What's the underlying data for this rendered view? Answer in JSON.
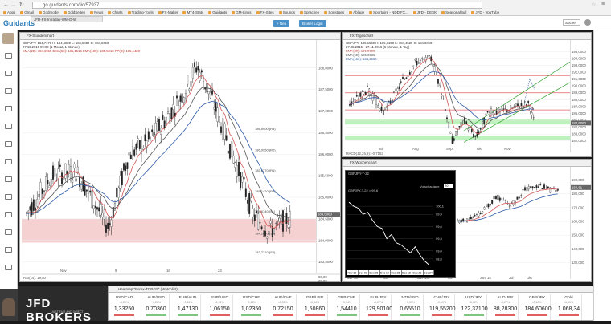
{
  "browser": {
    "url": "go.guidants.com/#c/57937",
    "bookmarks": [
      "Apps",
      "Gmail",
      "Godmode",
      "GoldSeiten",
      "News",
      "Charts",
      "Trading-Tools",
      "FX-Maker",
      "MT4-Stats",
      "Guidants",
      "GM-Links",
      "FX-Sites",
      "Sounds",
      "Sprachen",
      "Sonstiges",
      "Ablage",
      "Sportwire - NDD FX...",
      "JFD - DESK",
      "SeasonalBull",
      "JFD - YouTube"
    ]
  },
  "app": {
    "logo": "Guidants",
    "tab_label": "JFD-FX-Intraday-WM-D-W",
    "new_button": "+ Neu",
    "broker_button": "Broker Login",
    "search_label": "Suche"
  },
  "panels": {
    "stunden": {
      "title": "FX-Stundenchart",
      "info1": "GBPJPY: 184,7170  H: 184,6800  L: 184,5880  C: 184,6060",
      "info2": "27.10.2015 09:00 (1 Monat, 1 Stunde)",
      "info3": "EMA(20): 184,6965  EMA(50): 185,1516  EMA(100): 185,5016  PP(D): 185,1420",
      "price_labels": [
        "188,0000",
        "187,5000",
        "187,0000",
        "186,5000",
        "186,0000",
        "185,5000",
        "185,0000",
        "184,5000",
        "184,0000",
        "183,5000"
      ],
      "level_labels": [
        {
          "text": "186,5900 (R3)"
        },
        {
          "text": "186,0950 (R2)"
        },
        {
          "text": "185,6270 (R1)"
        },
        {
          "text": "185,1420 (PP)"
        },
        {
          "text": "184,6740 (S1)"
        },
        {
          "text": "184,1640 (S2)"
        },
        {
          "text": "183,7210 (S3)"
        }
      ],
      "current_price": "184,6060",
      "x_labels": [
        "Nov",
        "9",
        "16",
        "23"
      ],
      "rsi_label": "RSI(14): 19,50",
      "rsi_levels": [
        "80,00",
        "20,00"
      ]
    },
    "tages": {
      "title": "FX-Tageschart",
      "info1": "GBPJPY: 185,1560  H: 185,3150  L: 184,4520  C: 184,6060",
      "info2": "27.05.2015 - 27.11.2015 (6 Monate, 1 Tag)",
      "info3": "EMA(20): 185,9638",
      "info4": "EMA(50): 185,8536",
      "info5": "EMA(100): 185,2050",
      "price_labels": [
        "195,0000",
        "194,0000",
        "193,0000",
        "192,0000",
        "191,0000",
        "190,0000",
        "189,0000",
        "188,0000",
        "187,0000",
        "186,0000",
        "185,0000",
        "184,0000",
        "183,0000",
        "182,0000"
      ],
      "current_price": "184,6060",
      "x_labels": [
        "Jul",
        "Aug",
        "Sep",
        "Okt",
        "Nov"
      ],
      "macd_label": "MACD(12,26,9): -0,7153"
    },
    "wochen": {
      "title": "FX-Wochenchart",
      "price_labels": [
        "190,000",
        "180,000",
        "170,000",
        "160,000",
        "150,000",
        "140,000",
        "130,000"
      ],
      "current_price": "184,61",
      "x_labels": [
        "Jan '13",
        "Jul",
        "Jan '14",
        "Jul",
        "Jan '15",
        "Jul",
        "Okt"
      ]
    },
    "mini": {
      "title": "GBPJPY-T-22",
      "info": "GBPJPY-T-22 = 99,6",
      "dropdown": "Vorschautage",
      "dropdown_value": "20",
      "y_labels": [
        "100,1",
        "99,9",
        "99,6",
        "99,3",
        "99,0",
        "98,8"
      ],
      "x_labels": [
        "Nov 30",
        "Dec 03",
        "Dec 08",
        "Dec 10",
        "Dec 15",
        "Dec 18",
        "Dec 21",
        "Dec 24"
      ]
    }
  },
  "quotes": {
    "title": "Heatmap \"Forex-TOP-15\" (Watchlist)",
    "items": [
      {
        "symbol": "USD/CAD",
        "change": "-0,21%",
        "value": "1,33250",
        "color": "#e06060"
      },
      {
        "symbol": "AUD/USD",
        "change": "+0,22%",
        "value": "0,70360",
        "color": "#7fc47f"
      },
      {
        "symbol": "EUR/AUD",
        "change": "+0,61%",
        "value": "1,47130",
        "color": "#7fc47f"
      },
      {
        "symbol": "EUR/USD",
        "change": "-0,12%",
        "value": "1,06150",
        "color": "#e06060"
      },
      {
        "symbol": "USD/CHF",
        "change": "+0,18%",
        "value": "1,02350",
        "color": "#7fc47f"
      },
      {
        "symbol": "AUD/CHF",
        "change": "-0,05%",
        "value": "0,72150",
        "color": "#e06060"
      },
      {
        "symbol": "GBP/USD",
        "change": "-0,34%",
        "value": "1,50860",
        "color": "#e06060"
      },
      {
        "symbol": "GBP/CHF",
        "change": "+0,14%",
        "value": "1,54410",
        "color": "#7fc47f"
      },
      {
        "symbol": "EUR/JPY",
        "change": "-0,07%",
        "value": "129,90100",
        "color": "#e06060"
      },
      {
        "symbol": "NZD/USD",
        "change": "+0,03%",
        "value": "0,65510",
        "color": "#7fc47f"
      },
      {
        "symbol": "CHF/JPY",
        "change": "-0,19%",
        "value": "119,55200",
        "color": "#e06060"
      },
      {
        "symbol": "USD/JPY",
        "change": "+0,02%",
        "value": "122,37100",
        "color": "#7fc47f"
      },
      {
        "symbol": "AUD/JPY",
        "change": "-0,27%",
        "value": "88,28300",
        "color": "#e06060"
      },
      {
        "symbol": "GBP/JPY",
        "change": "-0,40%",
        "value": "184,60600",
        "color": "#e06060"
      },
      {
        "symbol": "Gold",
        "change": "-0,31%",
        "value": "1.068,34",
        "color": "#e06060"
      }
    ]
  },
  "banner": {
    "brand": "JFD BROKERS",
    "tagline": "JUST FAIR AND DIRECT"
  }
}
